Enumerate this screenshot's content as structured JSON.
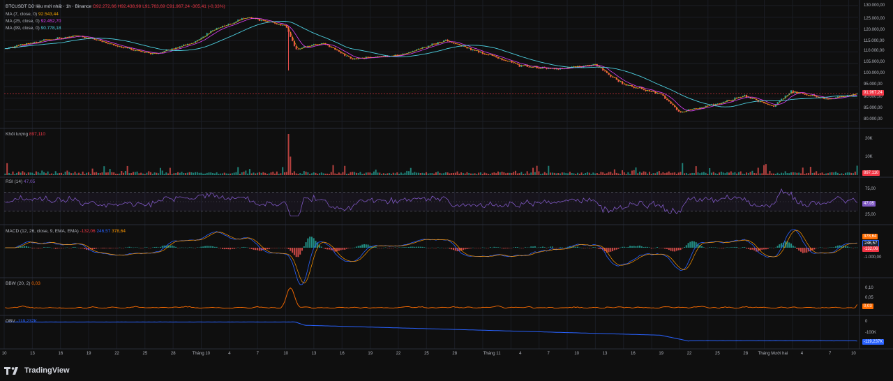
{
  "header": {
    "symbol": "BTCUSDT Dữ liệu mới nhất · 1h · Binance",
    "open_label": "O",
    "open": "92.272,66",
    "high_label": "H",
    "high": "92.438,98",
    "low_label": "L",
    "low": "91.763,69",
    "close_label": "C",
    "close": "91.967,24",
    "change": "-305,41 (-0,33%)"
  },
  "ma": [
    {
      "label": "MA (7, close, 0)",
      "value": "92.543,44",
      "color": "#f7a600"
    },
    {
      "label": "MA (25, close, 0)",
      "value": "92.452,70",
      "color": "#e040fb"
    },
    {
      "label": "MA (99, close, 0)",
      "value": "90.778,18",
      "color": "#4dd0e1"
    }
  ],
  "price_axis": [
    "130.000,00",
    "125.000,00",
    "120.000,00",
    "115.000,00",
    "110.000,00",
    "105.000,00",
    "100.000,00",
    "95.000,00",
    "90.000,00",
    "85.000,00",
    "80.000,00"
  ],
  "price_tag": "91.967,24",
  "volume": {
    "label": "Khối lượng",
    "value": "897,110",
    "axis": [
      "20K",
      "10K"
    ],
    "tag": "897,110"
  },
  "rsi": {
    "label": "RSI (14)",
    "value": "47,05",
    "axis": [
      "75,00",
      "25,00"
    ],
    "tag": "47,05"
  },
  "macd": {
    "label": "MACD (12, 26, close, 9, EMA, EMA)",
    "v1": "-132,06",
    "v2": "246,57",
    "v3": "378,64",
    "axis_low": "-1.000,00",
    "tags": [
      "378,64",
      "246,57",
      "-132,06"
    ]
  },
  "bbw": {
    "label": "BBW (20, 2)",
    "value": "0,03",
    "axis": [
      "0,10",
      "0,05"
    ],
    "tag": "0,03"
  },
  "obv": {
    "label": "OBV",
    "value": "-119,237K",
    "axis": [
      "0",
      "-100K"
    ],
    "tag": "-119,237K"
  },
  "time_axis": [
    "10",
    "13",
    "16",
    "19",
    "22",
    "25",
    "28",
    "Tháng 10",
    "4",
    "7",
    "10",
    "13",
    "16",
    "19",
    "22",
    "25",
    "28",
    "Tháng 11",
    "4",
    "7",
    "10",
    "13",
    "16",
    "19",
    "22",
    "25",
    "28",
    "Tháng Mười hai",
    "4",
    "7",
    "10"
  ],
  "brand": "TradingView",
  "colors": {
    "up": "#26a69a",
    "down": "#ef5350",
    "rsi": "#7e57c2",
    "bbw": "#ff6d00",
    "obv": "#2962ff",
    "macd": "#2962ff",
    "signal": "#ff9800"
  },
  "chart_data": {
    "type": "candlestick",
    "title": "BTCUSDT 1h",
    "ylim": [
      80000,
      130000
    ],
    "price_path_keypoints": [
      {
        "x": "Sep 10",
        "y": 111500
      },
      {
        "x": "Sep 14",
        "y": 115000
      },
      {
        "x": "Sep 18",
        "y": 117000
      },
      {
        "x": "Sep 22",
        "y": 112500
      },
      {
        "x": "Sep 26",
        "y": 109000
      },
      {
        "x": "Sep 30",
        "y": 114000
      },
      {
        "x": "Oct 3",
        "y": 121000
      },
      {
        "x": "Oct 6",
        "y": 125000
      },
      {
        "x": "Oct 10",
        "y": 121000
      },
      {
        "x": "Oct 11",
        "y": 111000
      },
      {
        "x": "Oct 14",
        "y": 114000
      },
      {
        "x": "Oct 17",
        "y": 107000
      },
      {
        "x": "Oct 22",
        "y": 108500
      },
      {
        "x": "Oct 27",
        "y": 115000
      },
      {
        "x": "Oct 31",
        "y": 109500
      },
      {
        "x": "Nov 4",
        "y": 104000
      },
      {
        "x": "Nov 8",
        "y": 102500
      },
      {
        "x": "Nov 12",
        "y": 104500
      },
      {
        "x": "Nov 15",
        "y": 96000
      },
      {
        "x": "Nov 19",
        "y": 92000
      },
      {
        "x": "Nov 21",
        "y": 84000
      },
      {
        "x": "Nov 25",
        "y": 87500
      },
      {
        "x": "Nov 28",
        "y": 91000
      },
      {
        "x": "Dec 1",
        "y": 86500
      },
      {
        "x": "Dec 3",
        "y": 93000
      },
      {
        "x": "Dec 7",
        "y": 89500
      },
      {
        "x": "Dec 10",
        "y": 91967
      }
    ],
    "rsi_levels": [
      75,
      25
    ],
    "volume_spike": {
      "x": "Oct 10",
      "value": 20000
    }
  }
}
